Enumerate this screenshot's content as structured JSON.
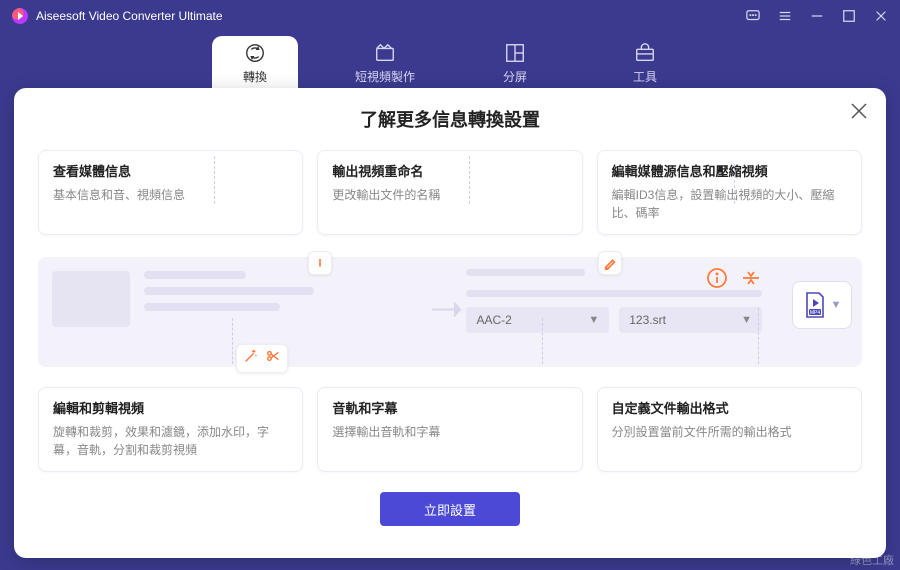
{
  "app": {
    "title": "Aiseesoft Video Converter Ultimate"
  },
  "nav": {
    "convert": "轉換",
    "mv": "短視頻製作",
    "collage": "分屏",
    "toolbox": "工具"
  },
  "panel": {
    "title": "了解更多信息轉換設置",
    "cta": "立即設置"
  },
  "cards": {
    "top1": {
      "title": "查看媒體信息",
      "desc": "基本信息和音、視頻信息"
    },
    "top2": {
      "title": "輸出視頻重命名",
      "desc": "更改輸出文件的名稱"
    },
    "top3": {
      "title": "編輯媒體源信息和壓縮視頻",
      "desc": "編輯ID3信息，設置輸出視頻的大小、壓縮比、碼率"
    },
    "bot1": {
      "title": "編輯和剪輯視頻",
      "desc": "旋轉和裁剪，效果和濾鏡，添加水印，字幕，音軌，分割和裁剪視頻"
    },
    "bot2": {
      "title": "音軌和字幕",
      "desc": "選擇輸出音軌和字幕"
    },
    "bot3": {
      "title": "自定義文件輸出格式",
      "desc": "分別設置當前文件所需的輸出格式"
    }
  },
  "work": {
    "audio_select": "AAC-2",
    "subtitle_select": "123.srt",
    "format_label": "MP4"
  },
  "watermark": "綠色工廠"
}
